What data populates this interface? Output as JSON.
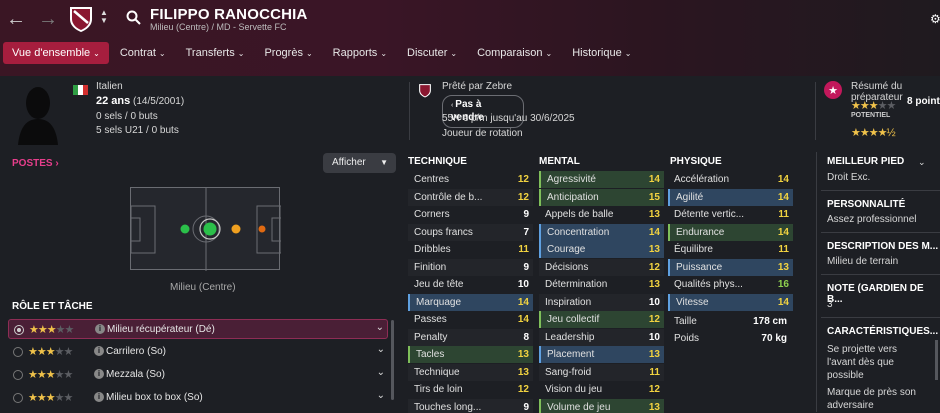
{
  "player": {
    "name": "FILIPPO RANOCCHIA",
    "subtitle": "Milieu (Centre) / MD - Servette FC"
  },
  "nav": {
    "back": "←",
    "forward": "→",
    "search_glyph": "🔍"
  },
  "menu": [
    "Vue d'ensemble",
    "Contrat",
    "Transferts",
    "Progrès",
    "Rapports",
    "Discuter",
    "Comparaison",
    "Historique"
  ],
  "bio": {
    "nationality": "Italien",
    "age": "22 ans",
    "dob": "(14/5/2001)",
    "caps": "0 sels / 0 buts",
    "u21": "5 sels U21 / 0 buts"
  },
  "loan": {
    "label": "Prêté par Zebre",
    "status_button": "Pas à vendre",
    "wage": "55K € p/m jusqu'au 30/6/2025",
    "role": "Joueur de rotation"
  },
  "scout": {
    "title": "Résumé du préparateur",
    "points": "8 point",
    "potential_label": "POTENTIEL",
    "ability_stars": 3,
    "potential_stars": 4.5
  },
  "positions": {
    "title": "POSTES",
    "show_button": "Afficher",
    "label": "Milieu (Centre)"
  },
  "roles": {
    "title": "RÔLE ET TÂCHE",
    "items": [
      {
        "label": "Milieu récupérateur (Dé)",
        "stars": 3,
        "selected": true
      },
      {
        "label": "Carrilero (So)",
        "stars": 3,
        "selected": false
      },
      {
        "label": "Mezzala (So)",
        "stars": 3,
        "selected": false
      },
      {
        "label": "Milieu box to box (So)",
        "stars": 3,
        "selected": false
      }
    ]
  },
  "technique": {
    "title": "TECHNIQUE",
    "items": [
      [
        "Centres",
        12
      ],
      [
        "Contrôle de b...",
        12
      ],
      [
        "Corners",
        9
      ],
      [
        "Coups francs",
        7
      ],
      [
        "Dribbles",
        11
      ],
      [
        "Finition",
        9
      ],
      [
        "Jeu de tête",
        10
      ],
      [
        "Marquage",
        14
      ],
      [
        "Passes",
        14
      ],
      [
        "Penalty",
        8
      ],
      [
        "Tacles",
        13
      ],
      [
        "Technique",
        13
      ],
      [
        "Tirs de loin",
        12
      ],
      [
        "Touches long...",
        9
      ]
    ]
  },
  "mental": {
    "title": "MENTAL",
    "items": [
      [
        "Agressivité",
        14
      ],
      [
        "Anticipation",
        15
      ],
      [
        "Appels de balle",
        13
      ],
      [
        "Concentration",
        14
      ],
      [
        "Courage",
        13
      ],
      [
        "Décisions",
        12
      ],
      [
        "Détermination",
        13
      ],
      [
        "Inspiration",
        10
      ],
      [
        "Jeu collectif",
        12
      ],
      [
        "Leadership",
        10
      ],
      [
        "Placement",
        13
      ],
      [
        "Sang-froid",
        11
      ],
      [
        "Vision du jeu",
        12
      ],
      [
        "Volume de jeu",
        13
      ]
    ]
  },
  "physique": {
    "title": "PHYSIQUE",
    "items": [
      [
        "Accélération",
        14
      ],
      [
        "Agilité",
        14
      ],
      [
        "Détente vertic...",
        11
      ],
      [
        "Endurance",
        14
      ],
      [
        "Équilibre",
        11
      ],
      [
        "Puissance",
        13
      ],
      [
        "Qualités phys...",
        16
      ],
      [
        "Vitesse",
        14
      ]
    ],
    "height_label": "Taille",
    "height": "178 cm",
    "weight_label": "Poids",
    "weight": "70 kg"
  },
  "side": {
    "foot_title": "MEILLEUR PIED",
    "foot": "Droit Exc.",
    "pers_title": "PERSONNALITÉ",
    "pers": "Assez professionnel",
    "desc_title": "DESCRIPTION DES M...",
    "desc": "Milieu de terrain",
    "note_title": "NOTE (GARDIEN DE B...",
    "note": "3",
    "car_title": "CARACTÉRISTIQUES...",
    "car1": "Se projette vers l'avant dès que possible",
    "car2": "Marque de près son adversaire"
  },
  "colors": {
    "accent": "#a61e3e",
    "highlight_blue": "#2f4660",
    "highlight_green": "#2d4532",
    "value_yellow": "#f2d340",
    "value_green": "#8fd14f"
  }
}
